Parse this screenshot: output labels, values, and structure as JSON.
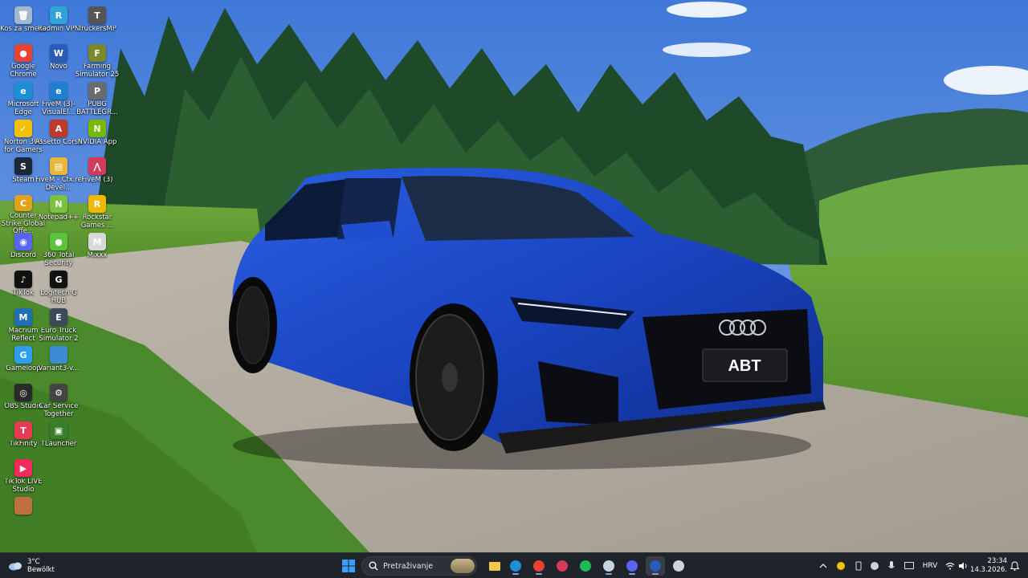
{
  "desktop": {
    "icons": [
      {
        "label": "Koš za smeće",
        "icon": "recycle-bin-icon",
        "color": "#9fb8d0",
        "glyph": "🗑"
      },
      {
        "label": "Radmin VPN",
        "icon": "radmin-vpn-icon",
        "color": "#2fa4d9",
        "glyph": "R"
      },
      {
        "label": "TruckersMP",
        "icon": "truckersmp-icon",
        "color": "#555555",
        "glyph": "T"
      },
      {
        "label": "Google Chrome",
        "icon": "chrome-icon",
        "color": "#e94235",
        "glyph": "●"
      },
      {
        "label": "Novo",
        "icon": "word-doc-icon",
        "color": "#2b5bb8",
        "glyph": "W"
      },
      {
        "label": "Farming Simulator 25",
        "icon": "farming-simulator-icon",
        "color": "#7a8a2a",
        "glyph": "F"
      },
      {
        "label": "Microsoft Edge",
        "icon": "edge-icon",
        "color": "#1d8fd6",
        "glyph": "e"
      },
      {
        "label": "FiveM (3)-VisualEl...",
        "icon": "fivem-icon",
        "color": "#1f7fd0",
        "glyph": "e"
      },
      {
        "label": "PUBG BATTLEGR...",
        "icon": "pubg-icon",
        "color": "#6b6b6b",
        "glyph": "P"
      },
      {
        "label": "Norton 360 for Gamers",
        "icon": "norton-icon",
        "color": "#f2c200",
        "glyph": "✓"
      },
      {
        "label": "Assetto Corsa",
        "icon": "assetto-corsa-icon",
        "color": "#c0392b",
        "glyph": "A"
      },
      {
        "label": "NVIDIA App",
        "icon": "nvidia-icon",
        "color": "#76b900",
        "glyph": "N"
      },
      {
        "label": "Steam",
        "icon": "steam-icon",
        "color": "#1b2838",
        "glyph": "S"
      },
      {
        "label": "FiveM - Cfx.re Devel...",
        "icon": "folder-icon",
        "color": "#e8b73a",
        "glyph": "▤"
      },
      {
        "label": "FiveM (3)",
        "icon": "fivem-red-icon",
        "color": "#d43a5a",
        "glyph": "⋀"
      },
      {
        "label": "Counter Strike Global Offe...",
        "icon": "csgo-icon",
        "color": "#e0a21a",
        "glyph": "C"
      },
      {
        "label": "Notepad++",
        "icon": "notepad-icon",
        "color": "#7cc242",
        "glyph": "N"
      },
      {
        "label": "Rockstar Games ...",
        "icon": "rockstar-icon",
        "color": "#f2b800",
        "glyph": "R"
      },
      {
        "label": "Discord",
        "icon": "discord-icon",
        "color": "#5865f2",
        "glyph": "◉"
      },
      {
        "label": "360 Total Security",
        "icon": "total-security-icon",
        "color": "#5cc43a",
        "glyph": "●"
      },
      {
        "label": "Mixxx",
        "icon": "mixxx-icon",
        "color": "#d9d9d9",
        "glyph": "M"
      },
      {
        "label": "TikTok",
        "icon": "tiktok-icon",
        "color": "#111111",
        "glyph": "♪"
      },
      {
        "label": "Logitech G HUB",
        "icon": "logitech-icon",
        "color": "#111111",
        "glyph": "G"
      },
      {
        "label": "Macrium Reflect",
        "icon": "macrium-icon",
        "color": "#1f6fb8",
        "glyph": "M"
      },
      {
        "label": "Euro Truck Simulator 2",
        "icon": "euro-truck-icon",
        "color": "#3a4a5a",
        "glyph": "E"
      },
      {
        "label": "Gameloop",
        "icon": "gameloop-icon",
        "color": "#2e9cf0",
        "glyph": "G"
      },
      {
        "label": "Variant3-v...",
        "icon": "file-icon",
        "color": "#3d8ad6",
        "glyph": ""
      },
      {
        "label": "OBS Studio",
        "icon": "obs-icon",
        "color": "#2a2a2a",
        "glyph": "◎"
      },
      {
        "label": "Car Service Together",
        "icon": "car-service-icon",
        "color": "#444444",
        "glyph": "⚙"
      },
      {
        "label": "TikFinity",
        "icon": "tikfinity-icon",
        "color": "#e83a55",
        "glyph": "T"
      },
      {
        "label": "TLauncher",
        "icon": "tlauncher-icon",
        "color": "#3a7d2a",
        "glyph": "▣"
      },
      {
        "label": "TikTok LIVE Studio",
        "icon": "tiktok-live-icon",
        "color": "#f02a5a",
        "glyph": "▶"
      },
      {
        "label": "",
        "icon": "partial-icon",
        "color": "#c07040",
        "glyph": ""
      }
    ]
  },
  "taskbar": {
    "weather": {
      "temp": "3°C",
      "condition": "Bewölkt"
    },
    "search_placeholder": "Pretraživanje",
    "apps": [
      {
        "name": "windows-start-icon",
        "color": "#3aa0ff"
      },
      {
        "name": "file-explorer-icon",
        "color": "#f2c94c"
      },
      {
        "name": "edge-icon",
        "color": "#1d8fd6"
      },
      {
        "name": "chrome-icon",
        "color": "#e94235"
      },
      {
        "name": "fivem-icon",
        "color": "#d43a5a"
      },
      {
        "name": "spotify-icon",
        "color": "#1db954"
      },
      {
        "name": "steam-icon",
        "color": "#c7d5e0"
      },
      {
        "name": "discord-icon",
        "color": "#5865f2"
      },
      {
        "name": "word-icon",
        "color": "#2b5bb8"
      },
      {
        "name": "settings-icon",
        "color": "#cfd3da"
      }
    ],
    "tray": {
      "language": "HRV",
      "time": "23:34",
      "date": "14.3.2026."
    }
  }
}
